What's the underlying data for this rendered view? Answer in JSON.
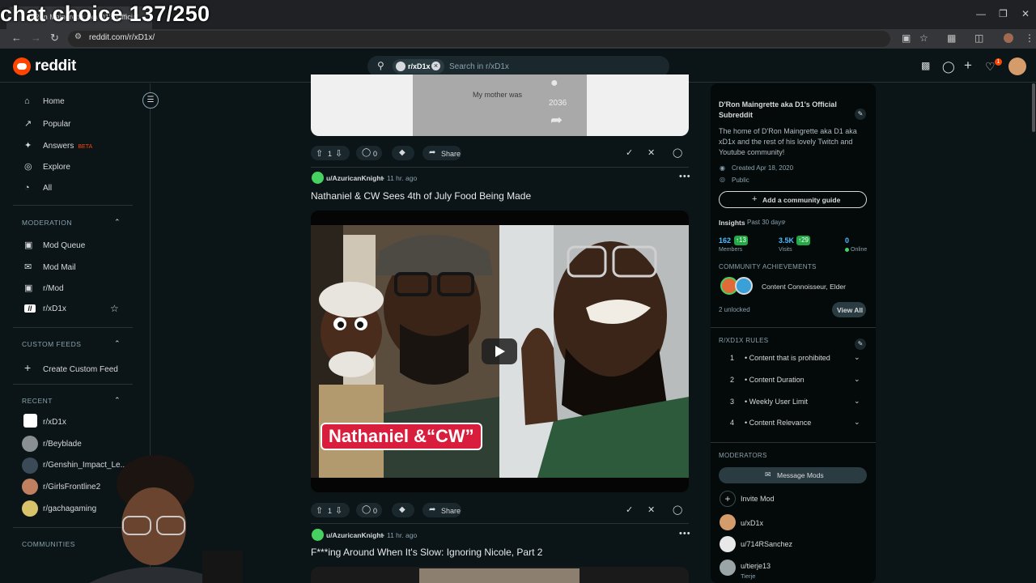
{
  "overlay": {
    "stream_text": "chat choice 137/250"
  },
  "browser": {
    "tab_title": "D'Ron Maingrette aka D1's Official",
    "url": "reddit.com/r/xD1x/"
  },
  "header": {
    "logo_text": "reddit",
    "search_chip": "r/xD1x",
    "search_placeholder": "Search in r/xD1x",
    "notification_count": "1"
  },
  "sidebar": {
    "main_items": [
      {
        "label": "Home",
        "icon": "home-icon"
      },
      {
        "label": "Popular",
        "icon": "popular-icon"
      },
      {
        "label": "Answers",
        "icon": "answers-icon",
        "badge": "BETA"
      },
      {
        "label": "Explore",
        "icon": "explore-icon"
      },
      {
        "label": "All",
        "icon": "all-icon"
      }
    ],
    "moderation_heading": "MODERATION",
    "moderation_items": [
      "Mod Queue",
      "Mod Mail",
      "r/Mod",
      "r/xD1x"
    ],
    "custom_feeds_heading": "CUSTOM FEEDS",
    "create_custom_feed": "Create Custom Feed",
    "recent_heading": "RECENT",
    "recent_items": [
      "r/xD1x",
      "r/Beyblade",
      "r/Genshin_Impact_Le...",
      "r/GirlsFrontline2",
      "r/gachagaming"
    ],
    "communities_heading": "COMMUNITIES"
  },
  "feed": {
    "top_post": {
      "video_text": "My mother was",
      "share_count": "2036",
      "votes": "1",
      "comments": "0",
      "share_label": "Share"
    },
    "post1": {
      "author": "u/AzuricanKnight",
      "time": "11 hr. ago",
      "title": "Nathaniel & CW Sees 4th of July Food Being Made",
      "caption": "Nathaniel &“CW”",
      "votes": "1",
      "comments": "0",
      "share_label": "Share"
    },
    "post2": {
      "author": "u/AzuricanKnight",
      "time": "11 hr. ago",
      "title": "F***ing Around When It's Slow: Ignoring Nicole, Part 2"
    }
  },
  "right_sidebar": {
    "title": "D'Ron Maingrette aka D1's Official Subreddit",
    "description": "The home of D'Ron Maingrette aka D1 aka xD1x and the rest of his lovely Twitch and Youtube community!",
    "created": "Created Apr 18, 2020",
    "visibility": "Public",
    "add_guide": "Add a community guide",
    "insights_label": "Insights",
    "insights_period": "Past 30 days",
    "members_value": "162",
    "members_delta": "13",
    "members_label": "Members",
    "visits_value": "3.5K",
    "visits_delta": "29",
    "visits_label": "Visits",
    "online_value": "0",
    "online_label": "Online",
    "achievements_heading": "COMMUNITY ACHIEVEMENTS",
    "achievements_text": "Content Connoisseur, Elder",
    "unlocked": "2 unlocked",
    "view_all": "View All",
    "rules_heading": "R/XD1X RULES",
    "rules": [
      {
        "num": "1",
        "text": "• Content that is prohibited"
      },
      {
        "num": "2",
        "text": "• Content Duration"
      },
      {
        "num": "3",
        "text": "• Weekly User Limit"
      },
      {
        "num": "4",
        "text": "• Content Relevance"
      }
    ],
    "moderators_heading": "MODERATORS",
    "message_mods": "Message Mods",
    "invite_mod": "Invite Mod",
    "moderators": [
      {
        "name": "u/xD1x",
        "flair": ""
      },
      {
        "name": "u/714RSanchez",
        "flair": ""
      },
      {
        "name": "u/tierje13",
        "flair": "Tierje"
      }
    ]
  }
}
